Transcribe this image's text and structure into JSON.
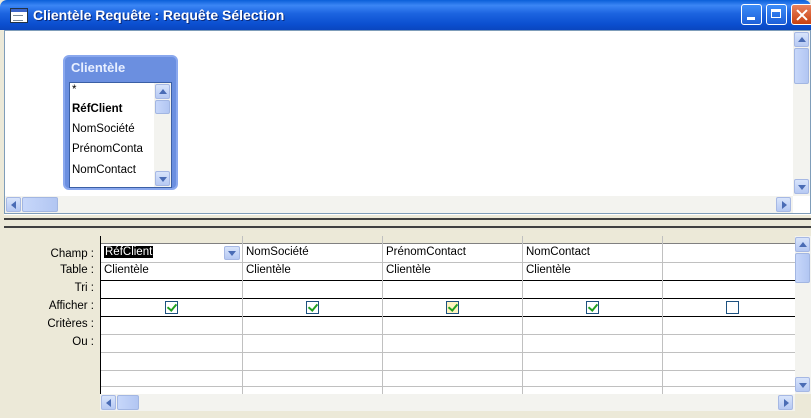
{
  "window": {
    "title": "Clientèle Requête : Requête Sélection",
    "icons": [
      "query-icon",
      "minimize-icon",
      "maximize-icon",
      "close-icon"
    ]
  },
  "table_pane": {
    "field_list": {
      "title": "Clientèle",
      "fields": [
        "*",
        "RéfClient",
        "NomSociété",
        "PrénomConta",
        "NomContact"
      ],
      "key_field": "RéfClient"
    }
  },
  "design_grid": {
    "row_labels": {
      "champ": "Champ :",
      "table": "Table :",
      "tri": "Tri :",
      "afficher": "Afficher :",
      "criteres": "Critères :",
      "ou": "Ou :"
    },
    "columns": [
      {
        "field": "RéfClient",
        "table": "Clientèle",
        "show": true
      },
      {
        "field": "NomSociété",
        "table": "Clientèle",
        "show": true
      },
      {
        "field": "PrénomContact",
        "table": "Clientèle",
        "show": true
      },
      {
        "field": "NomContact",
        "table": "Clientèle",
        "show": true
      },
      {
        "field": "",
        "table": "",
        "show": false
      }
    ]
  },
  "colors": {
    "titlebar": "#0a5fd8",
    "field_list_header": "#6b8fe0",
    "checkbox_check": "#21a121"
  }
}
